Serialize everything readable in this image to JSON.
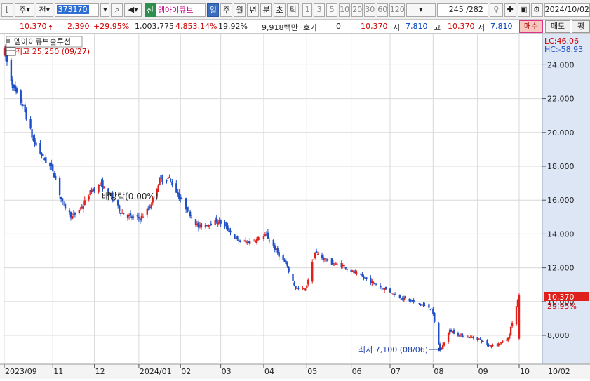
{
  "toolbar": {
    "period_label": "주",
    "market_label": "전",
    "stock_code": "373170",
    "new_badge": "신",
    "stock_name": "엠아이큐브",
    "interval_tabs": [
      "일",
      "주",
      "월",
      "년",
      "분",
      "초",
      "틱"
    ],
    "active_tab": "일",
    "minute_options": [
      "1",
      "3",
      "5",
      "10",
      "20",
      "30",
      "60",
      "120"
    ],
    "count_display": "245 /282",
    "date": "2024/10/02"
  },
  "quote": {
    "price": "10,370",
    "change": "2,390",
    "change_pct": "+29.95%",
    "volume": "1,003,775",
    "volume_pct": "4,853.14%",
    "turnover": "19.92%",
    "amount": "9,918백만",
    "hoga_label": "호가",
    "hoga_value": "0",
    "hoga_price": "10,370",
    "open_label": "시",
    "open": "7,810",
    "high_label": "고",
    "high": "10,370",
    "low_label": "저",
    "low": "7,810",
    "buy_label": "매수",
    "sell_label": "매도",
    "eval_label": "평"
  },
  "chart_data": {
    "type": "candlestick",
    "series_title": "엠아이큐브솔루션",
    "max_annotation": "최고 25,250 (09/27)",
    "min_annotation": "최저 7,100 (08/06)",
    "dividend_annotation": "배당락(0.00%)",
    "lc_label": "LC:46.06",
    "hc_label": "HC:-58.93",
    "last_price_label": "10,370",
    "last_pct_label": "29.95%",
    "ylim": [
      6300,
      25800
    ],
    "y_ticks": [
      "24,000",
      "22,000",
      "20,000",
      "18,000",
      "16,000",
      "14,000",
      "12,000",
      "10,000",
      "8,000"
    ],
    "y_tick_values": [
      24000,
      22000,
      20000,
      18000,
      16000,
      14000,
      12000,
      10000,
      8000
    ],
    "x_labels": [
      "2023/09",
      "11",
      "12",
      "2024/01",
      "02",
      "03",
      "04",
      "05",
      "06",
      "07",
      "08",
      "09",
      "10",
      "10/02"
    ],
    "close_path": [
      {
        "m": "2023-09-27",
        "v": 24800
      },
      {
        "m": "2023-10-04",
        "v": 22500
      },
      {
        "m": "2023-10-11",
        "v": 21500
      },
      {
        "m": "2023-10-18",
        "v": 19500
      },
      {
        "m": "2023-10-25",
        "v": 18500
      },
      {
        "m": "2023-11-01",
        "v": 17800
      },
      {
        "m": "2023-11-08",
        "v": 15800
      },
      {
        "m": "2023-11-15",
        "v": 15000
      },
      {
        "m": "2023-11-22",
        "v": 15600
      },
      {
        "m": "2023-11-29",
        "v": 16600
      },
      {
        "m": "2023-12-06",
        "v": 16900
      },
      {
        "m": "2023-12-13",
        "v": 16200
      },
      {
        "m": "2023-12-20",
        "v": 15300
      },
      {
        "m": "2023-12-27",
        "v": 15000
      },
      {
        "m": "2024-01-03",
        "v": 14900
      },
      {
        "m": "2024-01-10",
        "v": 15600
      },
      {
        "m": "2024-01-17",
        "v": 17200
      },
      {
        "m": "2024-01-24",
        "v": 17300
      },
      {
        "m": "2024-01-31",
        "v": 16200
      },
      {
        "m": "2024-02-07",
        "v": 15300
      },
      {
        "m": "2024-02-14",
        "v": 14400
      },
      {
        "m": "2024-02-21",
        "v": 14600
      },
      {
        "m": "2024-02-28",
        "v": 14800
      },
      {
        "m": "2024-03-06",
        "v": 14300
      },
      {
        "m": "2024-03-13",
        "v": 13600
      },
      {
        "m": "2024-03-20",
        "v": 13500
      },
      {
        "m": "2024-03-27",
        "v": 13700
      },
      {
        "m": "2024-04-03",
        "v": 13900
      },
      {
        "m": "2024-04-10",
        "v": 13000
      },
      {
        "m": "2024-04-17",
        "v": 12200
      },
      {
        "m": "2024-04-24",
        "v": 10800
      },
      {
        "m": "2024-05-01",
        "v": 10700
      },
      {
        "m": "2024-05-08",
        "v": 12900
      },
      {
        "m": "2024-05-15",
        "v": 12500
      },
      {
        "m": "2024-05-22",
        "v": 12200
      },
      {
        "m": "2024-05-29",
        "v": 12100
      },
      {
        "m": "2024-06-05",
        "v": 11700
      },
      {
        "m": "2024-06-12",
        "v": 11400
      },
      {
        "m": "2024-06-19",
        "v": 11100
      },
      {
        "m": "2024-06-26",
        "v": 10800
      },
      {
        "m": "2024-07-03",
        "v": 10500
      },
      {
        "m": "2024-07-10",
        "v": 10200
      },
      {
        "m": "2024-07-17",
        "v": 10000
      },
      {
        "m": "2024-07-24",
        "v": 9800
      },
      {
        "m": "2024-07-31",
        "v": 9600
      },
      {
        "m": "2024-08-06",
        "v": 7100
      },
      {
        "m": "2024-08-13",
        "v": 8300
      },
      {
        "m": "2024-08-20",
        "v": 8000
      },
      {
        "m": "2024-08-27",
        "v": 7900
      },
      {
        "m": "2024-09-03",
        "v": 7800
      },
      {
        "m": "2024-09-10",
        "v": 7400
      },
      {
        "m": "2024-09-17",
        "v": 7500
      },
      {
        "m": "2024-09-24",
        "v": 7800
      },
      {
        "m": "2024-10-02",
        "v": 10370
      }
    ],
    "colors": {
      "up": "#e0201a",
      "down": "#1f4fc8",
      "grid": "#d8d8d8",
      "axis_bg": "#dde6f5"
    }
  }
}
